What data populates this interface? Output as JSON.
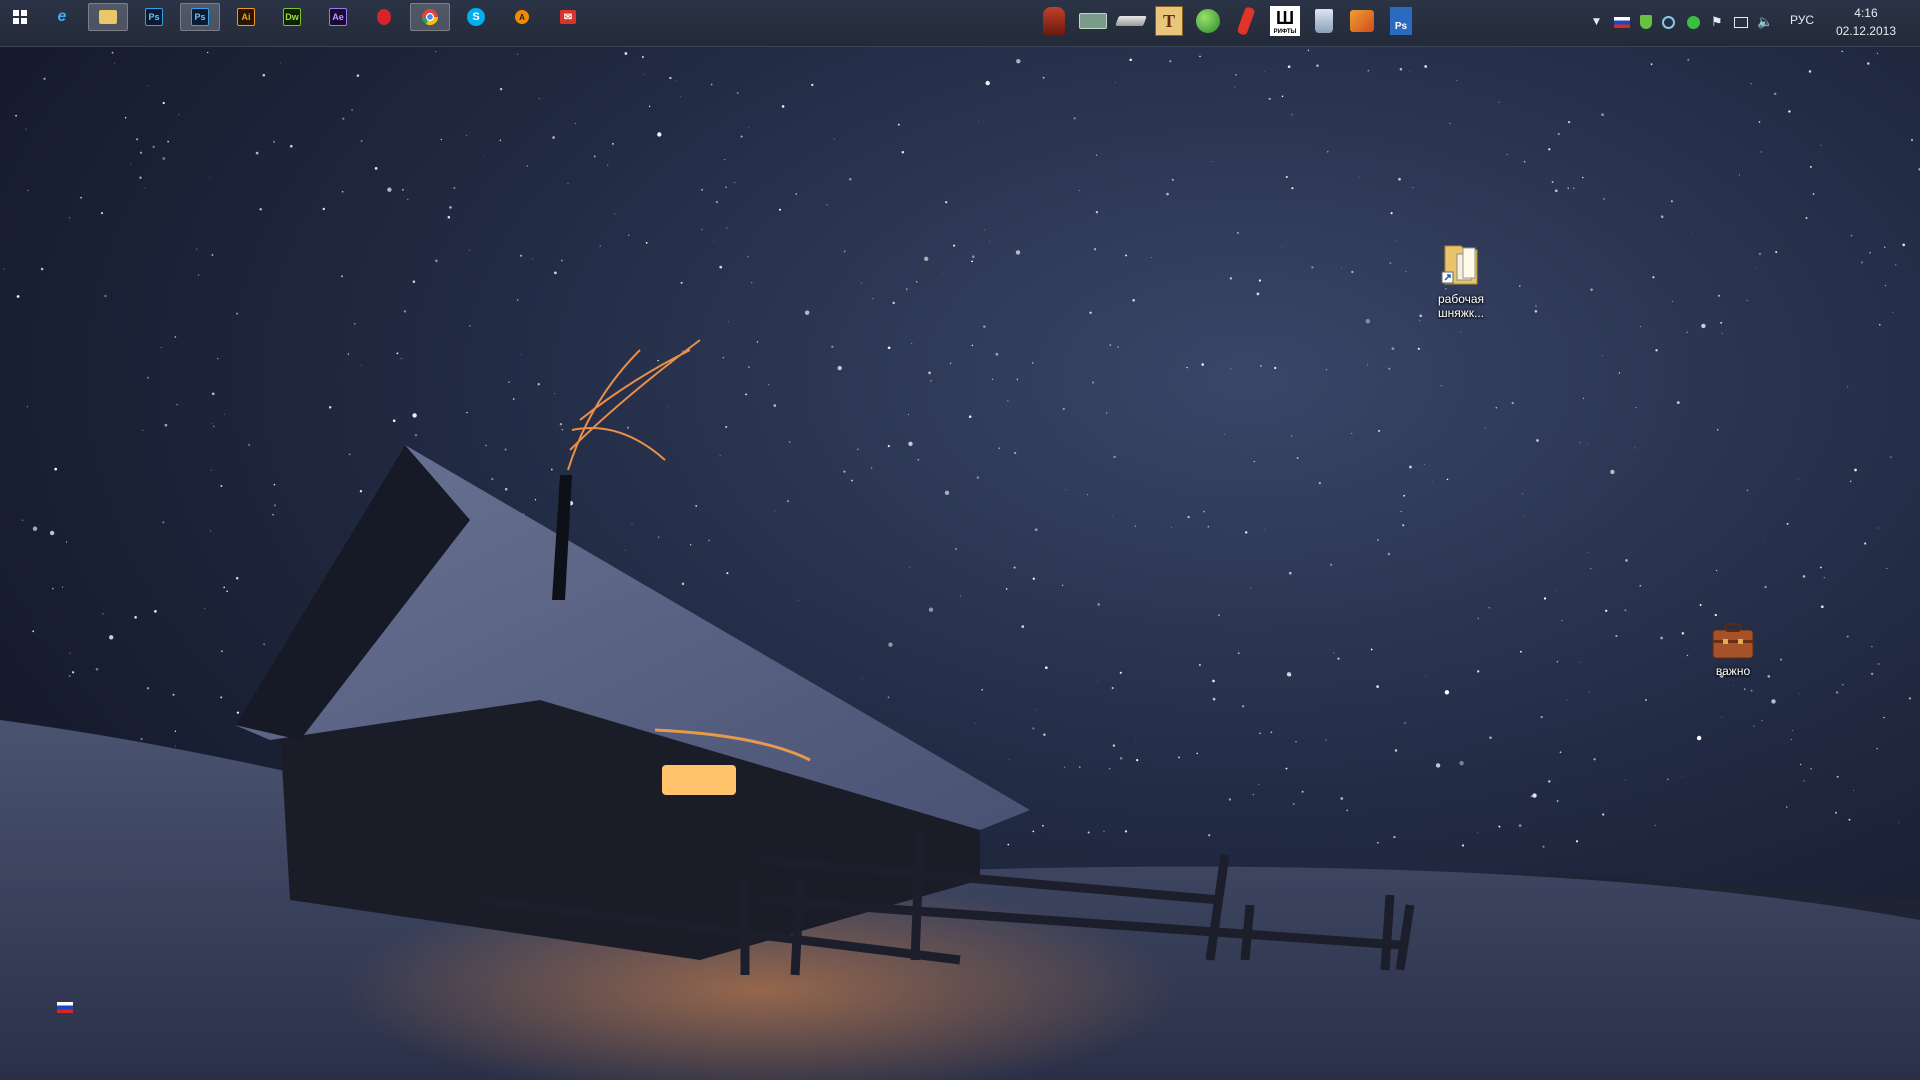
{
  "taskbar": {
    "start_icon": "windows-start-icon",
    "pinned": [
      {
        "name": "internet-explorer",
        "icon": "internet-explorer-icon",
        "active": false
      },
      {
        "name": "file-explorer",
        "icon": "folder-icon",
        "active": true
      },
      {
        "name": "photoshop-1",
        "icon": "photoshop-icon",
        "abbr": "Ps",
        "active": false
      },
      {
        "name": "photoshop-2",
        "icon": "photoshop-icon",
        "abbr": "Ps",
        "active": true
      },
      {
        "name": "illustrator",
        "icon": "illustrator-icon",
        "abbr": "Ai",
        "active": false
      },
      {
        "name": "dreamweaver",
        "icon": "dreamweaver-icon",
        "abbr": "Dw",
        "active": false
      },
      {
        "name": "after-effects",
        "icon": "after-effects-icon",
        "abbr": "Ae",
        "active": false
      },
      {
        "name": "opera",
        "icon": "opera-icon",
        "active": false
      },
      {
        "name": "chrome",
        "icon": "chrome-icon",
        "active": true
      },
      {
        "name": "skype",
        "icon": "skype-icon",
        "active": false
      },
      {
        "name": "avast",
        "icon": "avast-icon",
        "active": false
      },
      {
        "name": "mail",
        "icon": "mail-icon",
        "active": false
      }
    ],
    "quick_launch": [
      "warrior-game-icon",
      "scanner-icon",
      "drive-icon",
      "font-t-icon",
      "globe-icon",
      "red-tool-icon",
      "fonts-shrifty-icon",
      "recycle-bin-icon",
      "paint-icon",
      "photoshop-doc-icon"
    ],
    "quick_launch_text": {
      "fonts_label": "Ш",
      "fonts_sub": "РИФТЫ",
      "font_t": "T",
      "ps": "Ps"
    },
    "tray": {
      "icons": [
        "tray-expand-icon",
        "russian-flag-icon",
        "shield-icon",
        "sync-icon",
        "green-status-icon",
        "flag-icon",
        "network-icon",
        "volume-icon"
      ],
      "language": "РУС",
      "time": "4:16",
      "date": "02.12.2013"
    }
  },
  "desktop": {
    "icons": [
      {
        "label": "рабочая шняжк...",
        "icon": "folder-shortcut-icon"
      },
      {
        "label": "важно",
        "icon": "briefcase-icon"
      }
    ],
    "language_indicator_icon": "russian-flag-icon"
  },
  "colors": {
    "taskbar": "#232a39",
    "sky_dark": "#0f1422",
    "snow": "#3b4460",
    "window_glow": "#ffb347"
  }
}
